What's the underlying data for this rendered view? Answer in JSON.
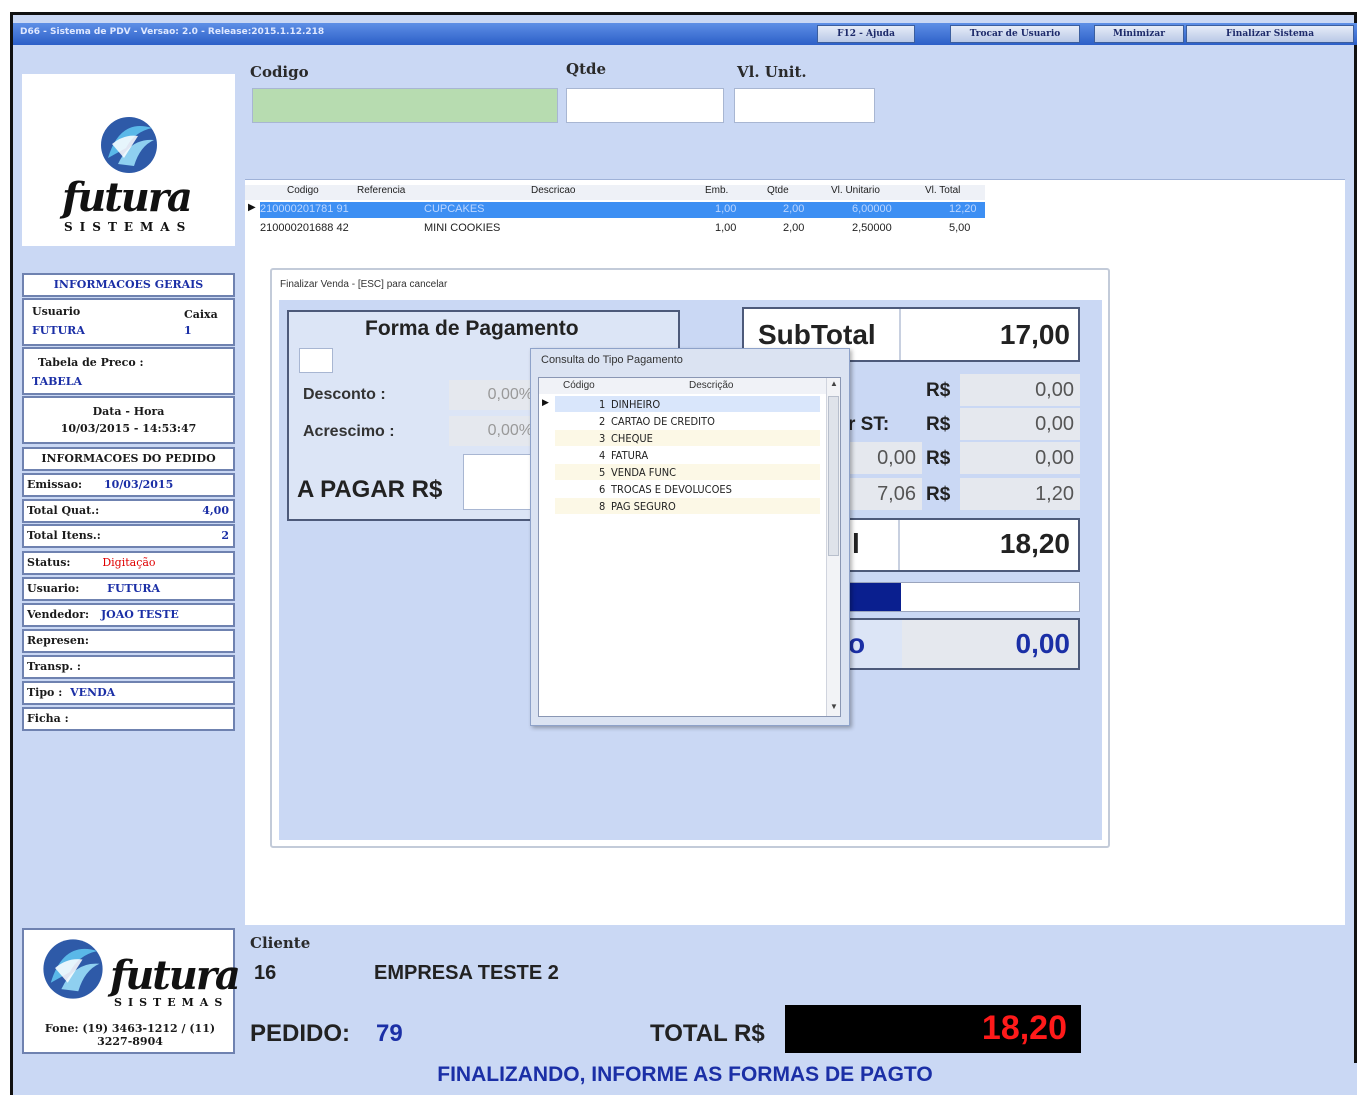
{
  "window": {
    "title": "D66 - Sistema de PDV - Versao: 2.0 - Release:2015.1.12.218",
    "buttons": [
      "F12 - Ajuda",
      "Trocar de Usuario",
      "Minimizar",
      "Finalizar Sistema"
    ]
  },
  "logo": {
    "brand": "futura",
    "sub": "SISTEMAS"
  },
  "sidebar": {
    "header_geral": "INFORMACOES GERAIS",
    "usuario_label": "Usuario",
    "usuario_value": "FUTURA",
    "caixa_label": "Caixa",
    "caixa_value": "1",
    "tabela_label": "Tabela de Preco :",
    "tabela_value": "TABELA",
    "datahora_label": "Data - Hora",
    "datahora_value": "10/03/2015 - 14:53:47",
    "header_pedido": "INFORMACOES DO PEDIDO",
    "emissao_label": "Emissao:",
    "emissao_value": "10/03/2015",
    "totalquat_label": "Total Quat.:",
    "totalquat_value": "4,00",
    "totalitens_label": "Total Itens.:",
    "totalitens_value": "2",
    "status_label": "Status:",
    "status_value": "Digitação",
    "usuario2_label": "Usuario:",
    "usuario2_value": "FUTURA",
    "vendedor_label": "Vendedor:",
    "vendedor_value": "JOAO TESTE",
    "represen_label": "Represen:",
    "transp_label": "Transp. :",
    "tipo_label": "Tipo :",
    "tipo_value": "VENDA",
    "ficha_label": "Ficha :",
    "fone": "Fone: (19) 3463-1212 / (11) 3227-8904"
  },
  "entry": {
    "codigo_label": "Codigo",
    "qtde_label": "Qtde",
    "vlunit_label": "Vl. Unit."
  },
  "items_grid": {
    "columns": [
      "Codigo",
      "Referencia",
      "Descricao",
      "Emb.",
      "Qtde",
      "Vl. Unitario",
      "Vl. Total"
    ],
    "rows": [
      [
        "210000201781 91",
        "",
        "CUPCAKES",
        "1,00",
        "2,00",
        "6,00000",
        "12,20"
      ],
      [
        "210000201688 42",
        "",
        "MINI COOKIES",
        "1,00",
        "2,00",
        "2,50000",
        "5,00"
      ]
    ]
  },
  "finalizar": {
    "title": "Finalizar Venda - [ESC] para cancelar",
    "forma_pagamento": "Forma de Pagamento",
    "desconto_label": "Desconto :",
    "desconto_pct": "0,00%",
    "acrescimo_label": "Acrescimo :",
    "acrescimo_pct": "0,00%",
    "apagar_label": "A PAGAR",
    "rs": "R$",
    "subtotal_label": "SubTotal",
    "subtotal_value": "17,00",
    "right_rows": [
      {
        "label": "",
        "pct": "",
        "value": "0,00"
      },
      {
        "label": "r ST:",
        "pct": "",
        "value": "0,00"
      },
      {
        "label": "",
        "pct": "0,00",
        "value": "0,00"
      },
      {
        "label": "",
        "pct": "7,06",
        "value": "1,20"
      }
    ],
    "total_label_frag": "l",
    "total_value": "18,20",
    "troco_label_frag": "o",
    "troco_value": "0,00"
  },
  "popup": {
    "title": "Consulta do Tipo Pagamento",
    "col_codigo": "Código",
    "col_descricao": "Descrição",
    "items": [
      {
        "codigo": "1",
        "descricao": "DINHEIRO"
      },
      {
        "codigo": "2",
        "descricao": "CARTAO DE CREDITO"
      },
      {
        "codigo": "3",
        "descricao": "CHEQUE"
      },
      {
        "codigo": "4",
        "descricao": "FATURA"
      },
      {
        "codigo": "5",
        "descricao": "VENDA FUNC"
      },
      {
        "codigo": "6",
        "descricao": "TROCAS E DEVOLUCOES"
      },
      {
        "codigo": "8",
        "descricao": "PAG SEGURO"
      }
    ]
  },
  "cliente": {
    "label": "Cliente",
    "codigo": "16",
    "nome": "EMPRESA TESTE 2"
  },
  "pedido": {
    "label": "PEDIDO:",
    "numero": "79"
  },
  "total": {
    "label": "TOTAL R$",
    "value": "18,20"
  },
  "status_message": "FINALIZANDO, INFORME AS FORMAS DE PAGTO",
  "colors": {
    "accent_blue": "#1b2fa6",
    "total_red": "#ff1a1a",
    "selection": "#3d8ff3"
  }
}
